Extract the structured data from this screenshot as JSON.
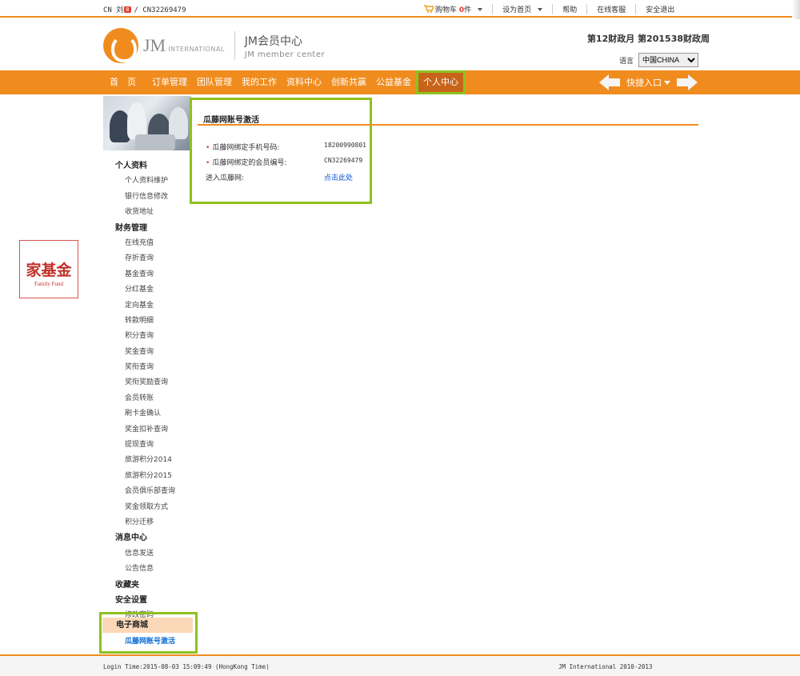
{
  "topbar": {
    "prefix": "CN",
    "user_name": "刘",
    "badge": "8",
    "member_id": "/ CN32269479",
    "cart_label": "购物车",
    "cart_count": "0",
    "cart_unit": "件",
    "set_home": "设为首页",
    "help": "帮助",
    "online_service": "在线客服",
    "logout": "安全退出"
  },
  "header": {
    "logo_jm": "JM",
    "logo_intl": "INTERNATIONAL",
    "center_title": "JM会员中心",
    "center_subtitle": "JM member center",
    "fiscal": "第12财政月  第201538财政周",
    "lang_label": "语言",
    "lang_selected": "中国CHINA"
  },
  "nav": {
    "items": [
      {
        "label": "首　页"
      },
      {
        "label": "订单管理"
      },
      {
        "label": "团队管理"
      },
      {
        "label": "我的工作"
      },
      {
        "label": "资料中心"
      },
      {
        "label": "创新共赢"
      },
      {
        "label": "公益基金"
      },
      {
        "label": "个人中心"
      }
    ],
    "quick_entry": "快捷入口"
  },
  "sidebar": {
    "sections": [
      {
        "title": "个人资料",
        "items": [
          "个人资料维护",
          "银行信息修改",
          "收货地址"
        ]
      },
      {
        "title": "财务管理",
        "items": [
          "在线充值",
          "存折查询",
          "基金查询",
          "分红基金",
          "定向基金",
          "转款明细",
          "积分查询",
          "奖金查询",
          "奖衔查询",
          "奖衔奖励查询",
          "会员转账",
          "刷卡金确认",
          "奖金扣补查询",
          "提现查询",
          "旅游积分2014",
          "旅游积分2015",
          "会员俱乐部查询",
          "奖金领取方式",
          "积分迁移"
        ]
      },
      {
        "title": "消息中心",
        "items": [
          "信息发送",
          "公告信息"
        ]
      },
      {
        "title": "收藏夹",
        "items": []
      },
      {
        "title": "安全设置",
        "items": [
          "修改密码"
        ]
      }
    ],
    "mall_title": "电子商城",
    "mall_item": "瓜藤网账号激活"
  },
  "fund": {
    "title": "家基金",
    "subtitle": "Family Fund"
  },
  "main": {
    "title": "瓜藤网账号激活",
    "phone_label": "瓜藤网绑定手机号码:",
    "phone_value": "18200990801",
    "member_label": "瓜藤网绑定的会员编号:",
    "member_value": "CN32269479",
    "enter_label": "进入瓜藤网:",
    "enter_link": "点击此处"
  },
  "footer": {
    "login_time": "Login Time:2015-08-03 15:09:49 (HongKong Time)",
    "copyright": "JM International 2010-2013"
  },
  "colors": {
    "brand_orange": "#f08c1e",
    "highlight_green": "#8dc21f",
    "link_blue": "#0b55d6"
  }
}
